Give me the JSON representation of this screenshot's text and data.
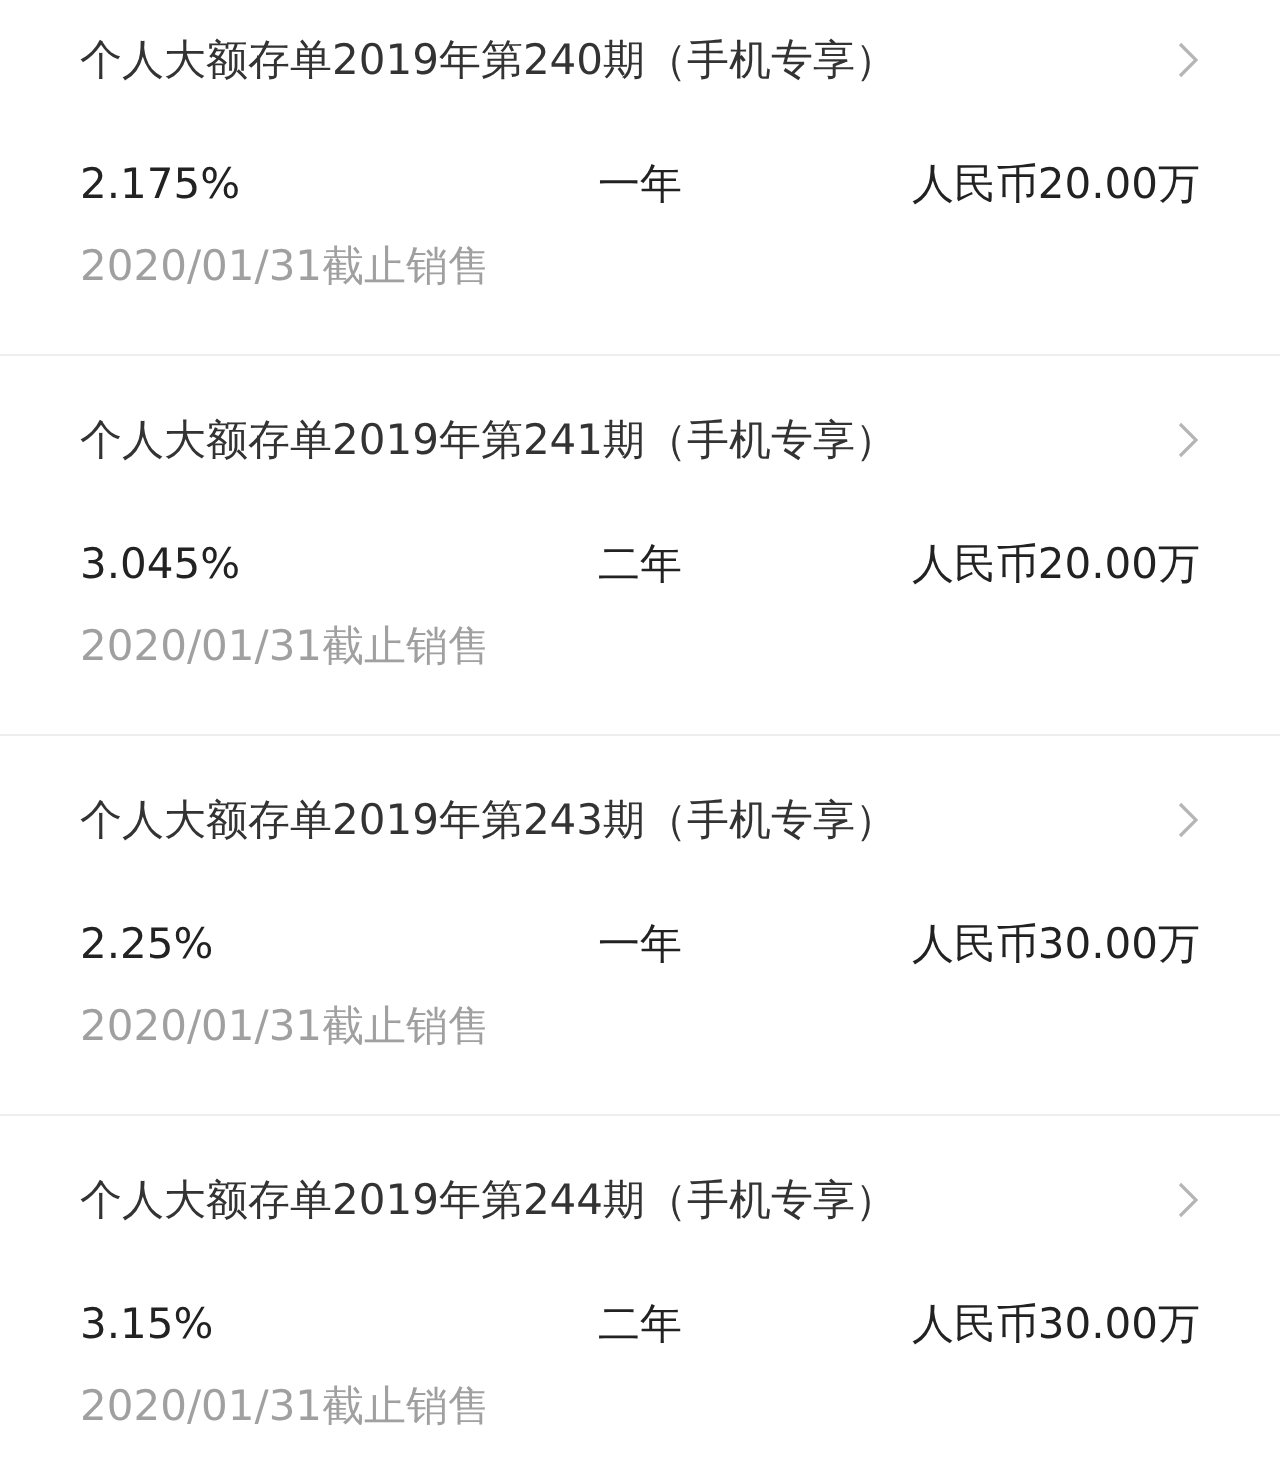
{
  "products": [
    {
      "title": "个人大额存单2019年第240期（手机专享）",
      "rate": "2.175%",
      "term": "一年",
      "amount": "人民币20.00万",
      "deadline": "2020/01/31截止销售"
    },
    {
      "title": "个人大额存单2019年第241期（手机专享）",
      "rate": "3.045%",
      "term": "二年",
      "amount": "人民币20.00万",
      "deadline": "2020/01/31截止销售"
    },
    {
      "title": "个人大额存单2019年第243期（手机专享）",
      "rate": "2.25%",
      "term": "一年",
      "amount": "人民币30.00万",
      "deadline": "2020/01/31截止销售"
    },
    {
      "title": "个人大额存单2019年第244期（手机专享）",
      "rate": "3.15%",
      "term": "二年",
      "amount": "人民币30.00万",
      "deadline": "2020/01/31截止销售"
    }
  ]
}
